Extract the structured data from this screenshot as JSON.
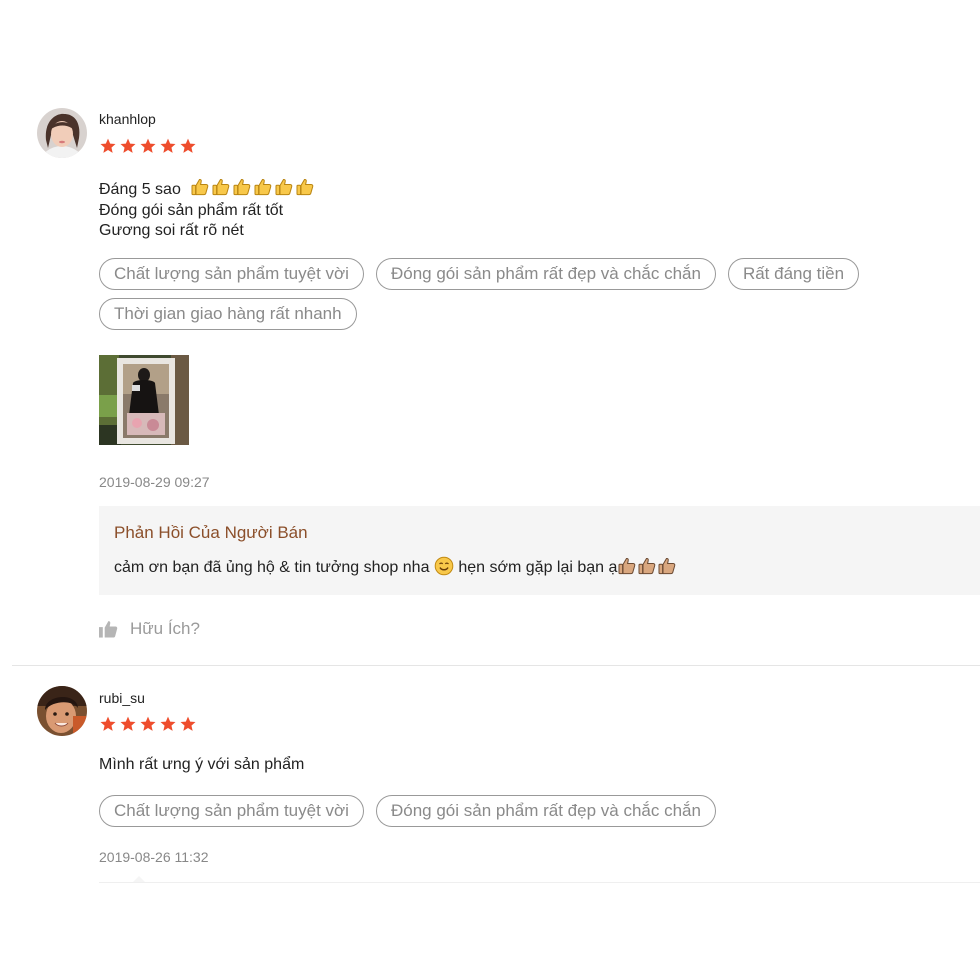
{
  "reviews": [
    {
      "username": "khanhlop",
      "rating": 5,
      "comment_lines": [
        "Đáng 5 sao",
        "Đóng gói sản phẩm rất tốt",
        "Gương soi rất rõ nét"
      ],
      "comment_emoji": "thumbs-up x6",
      "tags": [
        "Chất lượng sản phẩm tuyệt vời",
        "Đóng gói sản phẩm rất đẹp và chắc chắn",
        "Rất đáng tiền",
        "Thời gian giao hàng rất nhanh"
      ],
      "timestamp": "2019-08-29 09:27",
      "seller_reply": {
        "title": "Phản Hồi Của Người Bán",
        "text_before": "cảm ơn bạn đã ủng hộ & tin tưởng shop nha",
        "text_after": "hẹn sớm gặp lại bạn ạ"
      },
      "helpful_label": "Hữu Ích?"
    },
    {
      "username": "rubi_su",
      "rating": 5,
      "comment_lines": [
        "Mình rất ưng ý với sản phẩm"
      ],
      "tags": [
        "Chất lượng sản phẩm tuyệt vời",
        "Đóng gói sản phẩm rất đẹp và chắc chắn"
      ],
      "timestamp": "2019-08-26 11:32"
    }
  ],
  "colors": {
    "star": "#ee4d2d",
    "seller_reply_title": "#8b4f2a",
    "tag_border": "#999999",
    "reply_background": "#f5f5f5"
  },
  "icons": [
    "star-icon",
    "thumbs-up-icon",
    "smile-emoji-icon",
    "like-icon"
  ]
}
